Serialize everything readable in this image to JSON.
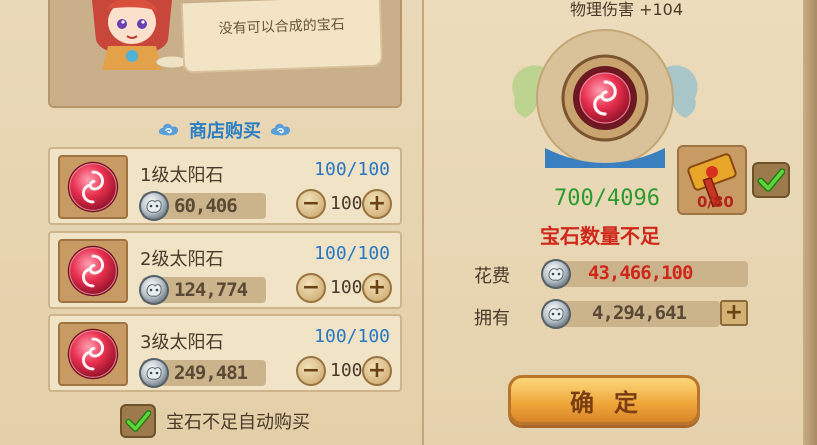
{
  "npc": {
    "speech": "没有可以合成的宝石"
  },
  "shop": {
    "title": "商店购买"
  },
  "items": [
    {
      "name": "1级太阳石",
      "stock": "100/100",
      "price": "60,406",
      "quantity": "100"
    },
    {
      "name": "2级太阳石",
      "stock": "100/100",
      "price": "124,774",
      "quantity": "100"
    },
    {
      "name": "3级太阳石",
      "stock": "100/100",
      "price": "249,481",
      "quantity": "100"
    }
  ],
  "auto_buy": {
    "label": "宝石不足自动购买",
    "checked": true
  },
  "synthesis": {
    "stat": "物理伤害 +104",
    "progress": "700/4096",
    "warning": "宝石数量不足",
    "material_count": "0/80",
    "material_checked": true
  },
  "cost": {
    "label": "花费",
    "value": "43,466,100",
    "color": "#d1271b"
  },
  "owned": {
    "label": "拥有",
    "value": "4,294,641"
  },
  "confirm": {
    "label": "确定"
  },
  "icons": {
    "gem": "sun-stone-gem-icon",
    "coin": "silver-coin-icon",
    "cloud": "cloud-ornament-icon",
    "check": "green-check-icon",
    "material": "golden-hammer-icon"
  },
  "colors": {
    "stock_blue": "#2878c4",
    "progress_green": "#2d9b2d",
    "warning_red": "#d1271b",
    "shop_title_blue": "#2c7fc2"
  }
}
